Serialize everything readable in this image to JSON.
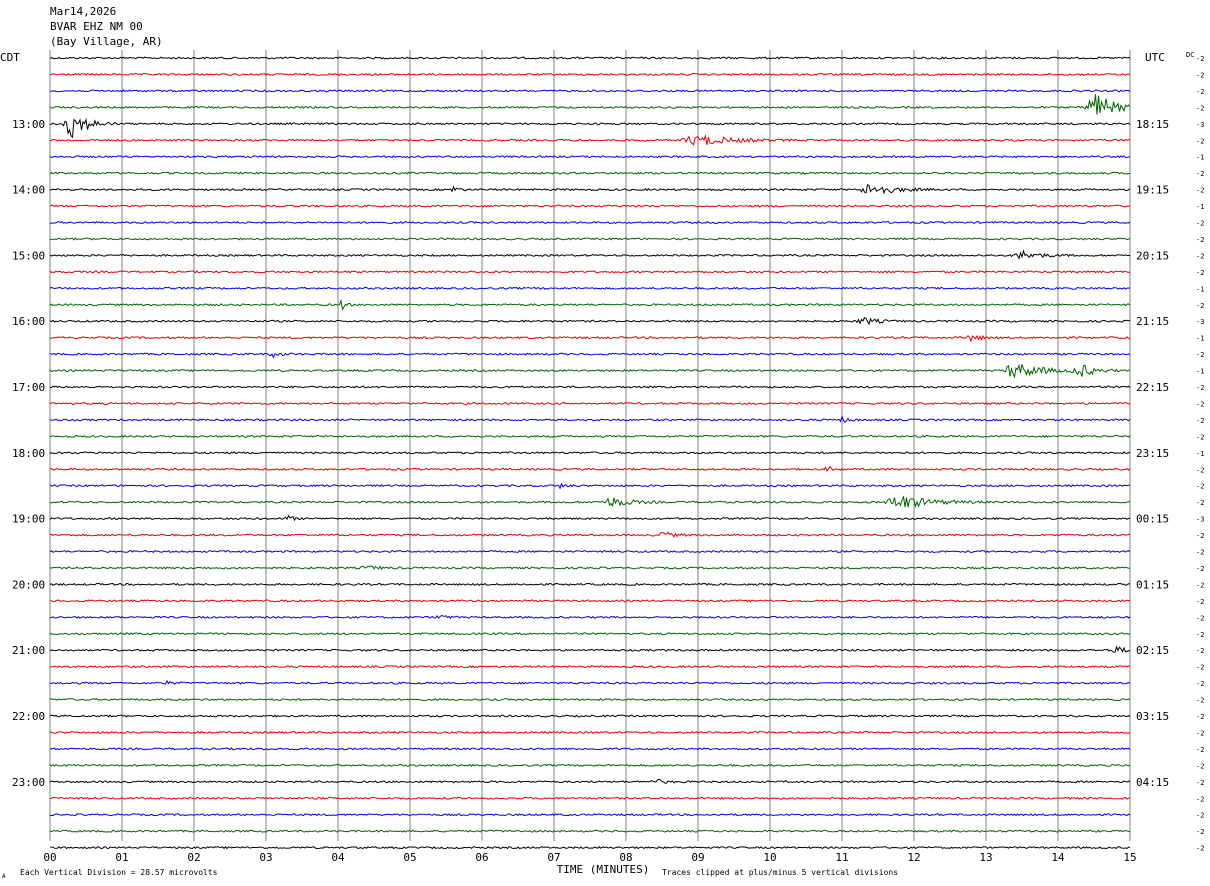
{
  "header": {
    "date": "Mar14,2026",
    "station": "BVAR EHZ NM 00",
    "location": "(Bay Village, AR)"
  },
  "left_tz": "CDT",
  "right_tz": "UTC",
  "dc_label": "DC",
  "footer": {
    "scale_note": "Each Vertical Division =   28.57 microvolts",
    "clip_note": "Traces clipped at plus/minus 5 vertical divisions",
    "corner_mark": "A"
  },
  "colors": {
    "trace_cycle": [
      "#000000",
      "#e00000",
      "#0000e0",
      "#006400"
    ],
    "grid": "#808080"
  },
  "chart_data": {
    "type": "line",
    "subtype": "helicorder",
    "xlabel": "TIME (MINUTES)",
    "x_ticks": [
      "00",
      "01",
      "02",
      "03",
      "04",
      "05",
      "06",
      "07",
      "08",
      "09",
      "10",
      "11",
      "12",
      "13",
      "14",
      "15"
    ],
    "xlim": [
      0,
      15
    ],
    "rows_per_hour": 4,
    "minutes_per_row": 15,
    "left_hour_labels": [
      "13:00",
      "14:00",
      "15:00",
      "16:00",
      "17:00",
      "18:00",
      "19:00",
      "20:00",
      "21:00",
      "22:00",
      "23:00"
    ],
    "right_hour_labels": [
      "18:15",
      "19:15",
      "20:15",
      "21:15",
      "22:15",
      "23:15",
      "00:15",
      "01:15",
      "02:15",
      "03:15",
      "04:15"
    ],
    "first_label_row": 4,
    "dc_offsets": [
      "-2",
      "-2",
      "-2",
      "-2",
      "-3",
      "-2",
      "-1",
      "-2",
      "-2",
      "-1",
      "-2",
      "-2",
      "-2",
      "-2",
      "-1",
      "-2",
      "-3",
      "-1",
      "-2",
      "-1",
      "-2",
      "-2",
      "-2",
      "-2",
      "-1",
      "-2",
      "-2",
      "-2",
      "-3",
      "-2",
      "-2",
      "-2",
      "-2",
      "-2",
      "-2",
      "-2",
      "-2",
      "-2",
      "-2",
      "-2",
      "-2",
      "-2",
      "-2",
      "-2",
      "-2",
      "-2",
      "-2",
      "-2",
      "-2"
    ],
    "events": [
      {
        "row": 3,
        "minute": 14.5,
        "amp": 5,
        "width": 0.5
      },
      {
        "row": 4,
        "minute": 0.3,
        "amp": 5,
        "width": 0.4
      },
      {
        "row": 5,
        "minute": 9.0,
        "amp": 1.6,
        "width": 0.9
      },
      {
        "row": 8,
        "minute": 11.4,
        "amp": 2.0,
        "width": 0.6
      },
      {
        "row": 8,
        "minute": 5.6,
        "amp": 1.0,
        "width": 0.15
      },
      {
        "row": 12,
        "minute": 13.5,
        "amp": 1.3,
        "width": 0.5
      },
      {
        "row": 15,
        "minute": 4.05,
        "amp": 1.5,
        "width": 0.12
      },
      {
        "row": 16,
        "minute": 11.3,
        "amp": 1.0,
        "width": 0.4
      },
      {
        "row": 17,
        "minute": 12.8,
        "amp": 1.0,
        "width": 0.3
      },
      {
        "row": 18,
        "minute": 3.1,
        "amp": 0.9,
        "width": 0.2
      },
      {
        "row": 19,
        "minute": 13.4,
        "amp": 2.4,
        "width": 0.7
      },
      {
        "row": 19,
        "minute": 14.3,
        "amp": 2.0,
        "width": 0.4
      },
      {
        "row": 22,
        "minute": 11.0,
        "amp": 0.8,
        "width": 0.2
      },
      {
        "row": 25,
        "minute": 10.8,
        "amp": 0.9,
        "width": 0.15
      },
      {
        "row": 26,
        "minute": 7.1,
        "amp": 0.8,
        "width": 0.15
      },
      {
        "row": 27,
        "minute": 7.8,
        "amp": 1.5,
        "width": 0.5
      },
      {
        "row": 27,
        "minute": 11.8,
        "amp": 2.2,
        "width": 0.8
      },
      {
        "row": 28,
        "minute": 3.3,
        "amp": 1.0,
        "width": 0.15
      },
      {
        "row": 29,
        "minute": 8.5,
        "amp": 1.0,
        "width": 0.3
      },
      {
        "row": 31,
        "minute": 4.4,
        "amp": 0.6,
        "width": 0.4
      },
      {
        "row": 34,
        "minute": 5.4,
        "amp": 0.8,
        "width": 0.2
      },
      {
        "row": 36,
        "minute": 14.8,
        "amp": 0.9,
        "width": 0.4
      },
      {
        "row": 38,
        "minute": 1.6,
        "amp": 0.5,
        "width": 0.2
      },
      {
        "row": 44,
        "minute": 8.4,
        "amp": 0.7,
        "width": 0.3
      }
    ]
  }
}
